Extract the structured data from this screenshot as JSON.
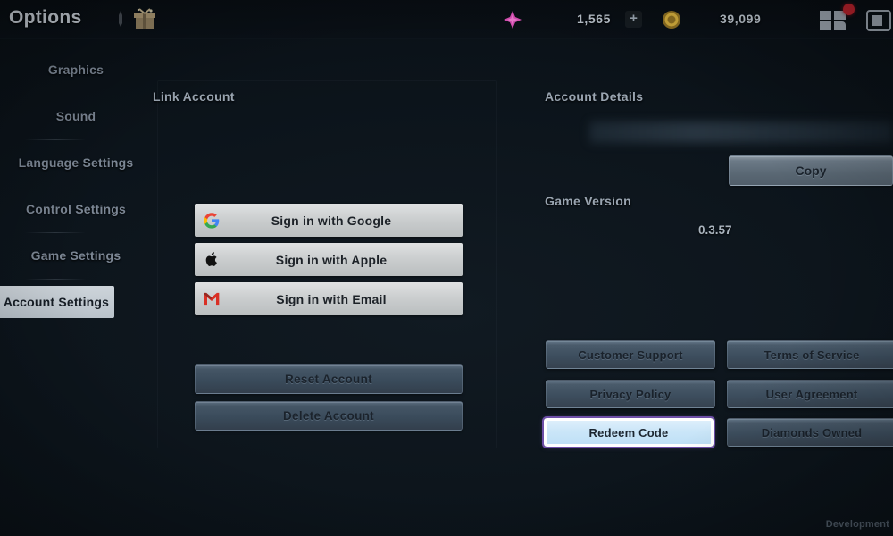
{
  "window": {
    "title": "Options"
  },
  "topbar": {
    "icons": {
      "sword": "sword-icon",
      "gift": "gift-icon",
      "grid": "grid-menu-icon",
      "shop": "shop-icon"
    },
    "currencies": [
      {
        "name": "diamond",
        "icon": "diamond-icon",
        "value": "1,565",
        "add_label": "+"
      },
      {
        "name": "gold",
        "icon": "gold-coin-icon",
        "value": "39,099"
      }
    ],
    "notification_badge": true
  },
  "sidebar": {
    "items": [
      {
        "label": "Graphics",
        "active": false
      },
      {
        "label": "Sound",
        "active": false
      },
      {
        "label": "Language Settings",
        "active": false
      },
      {
        "label": "Control Settings",
        "active": false
      },
      {
        "label": "Game Settings",
        "active": false
      },
      {
        "label": "Account Settings",
        "active": true
      }
    ]
  },
  "link_account": {
    "title": "Link Account",
    "social_buttons": [
      {
        "label": "Sign in with Google",
        "icon": "google-icon"
      },
      {
        "label": "Sign in with Apple",
        "icon": "apple-icon"
      },
      {
        "label": "Sign in with Email",
        "icon": "gmail-icon"
      }
    ],
    "account_actions": [
      {
        "label": "Reset Account"
      },
      {
        "label": "Delete Account"
      }
    ]
  },
  "account_details": {
    "title": "Account Details",
    "account_id": "",
    "copy_label": "Copy",
    "game_version_label": "Game Version",
    "game_version_value": "0.3.57"
  },
  "links": [
    {
      "label": "Customer Support",
      "selected": false
    },
    {
      "label": "Terms of Service",
      "selected": false
    },
    {
      "label": "Privacy Policy",
      "selected": false
    },
    {
      "label": "User Agreement",
      "selected": false
    },
    {
      "label": "Redeem Code",
      "selected": true
    },
    {
      "label": "Diamonds Owned",
      "selected": false
    }
  ],
  "footer": {
    "build_tag": "Development"
  },
  "colors": {
    "background": "#0a0f14",
    "panel_text": "#9aa5b1",
    "accent_selected": "#cbe6f8",
    "selection_outline": "#6e4fa8",
    "badge": "#b8222c",
    "diamond": "#d94fb4",
    "gold": "#c8a13a"
  }
}
